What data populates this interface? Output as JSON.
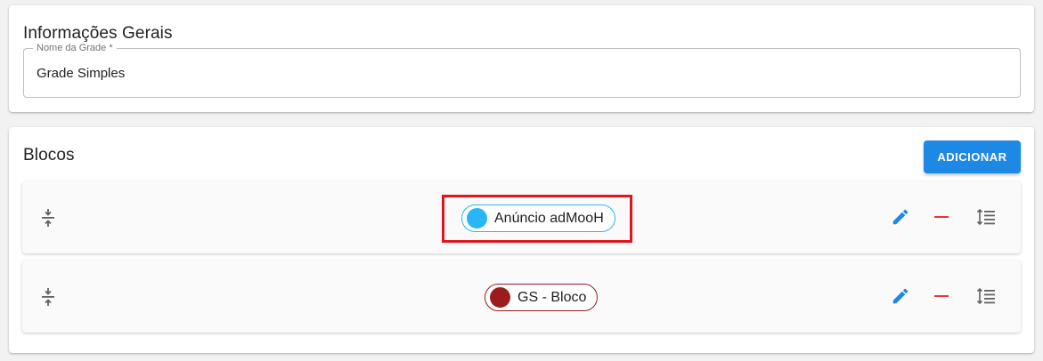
{
  "general": {
    "title": "Informações Gerais",
    "grade_name_label": "Nome da Grade *",
    "grade_name_value": "Grade Simples"
  },
  "blocks": {
    "title": "Blocos",
    "add_label": "ADICIONAR",
    "items": [
      {
        "name": "Anúncio adMooH",
        "color": "#29b6f6",
        "highlighted": true
      },
      {
        "name": "GS - Bloco",
        "color": "#9b1c1c",
        "highlighted": false
      }
    ]
  },
  "colors": {
    "primary": "#1e88e5",
    "remove": "#e53935",
    "highlight": "#e3141c"
  },
  "icons": [
    "drag-handle-icon",
    "edit-icon",
    "remove-icon",
    "sort-icon"
  ]
}
